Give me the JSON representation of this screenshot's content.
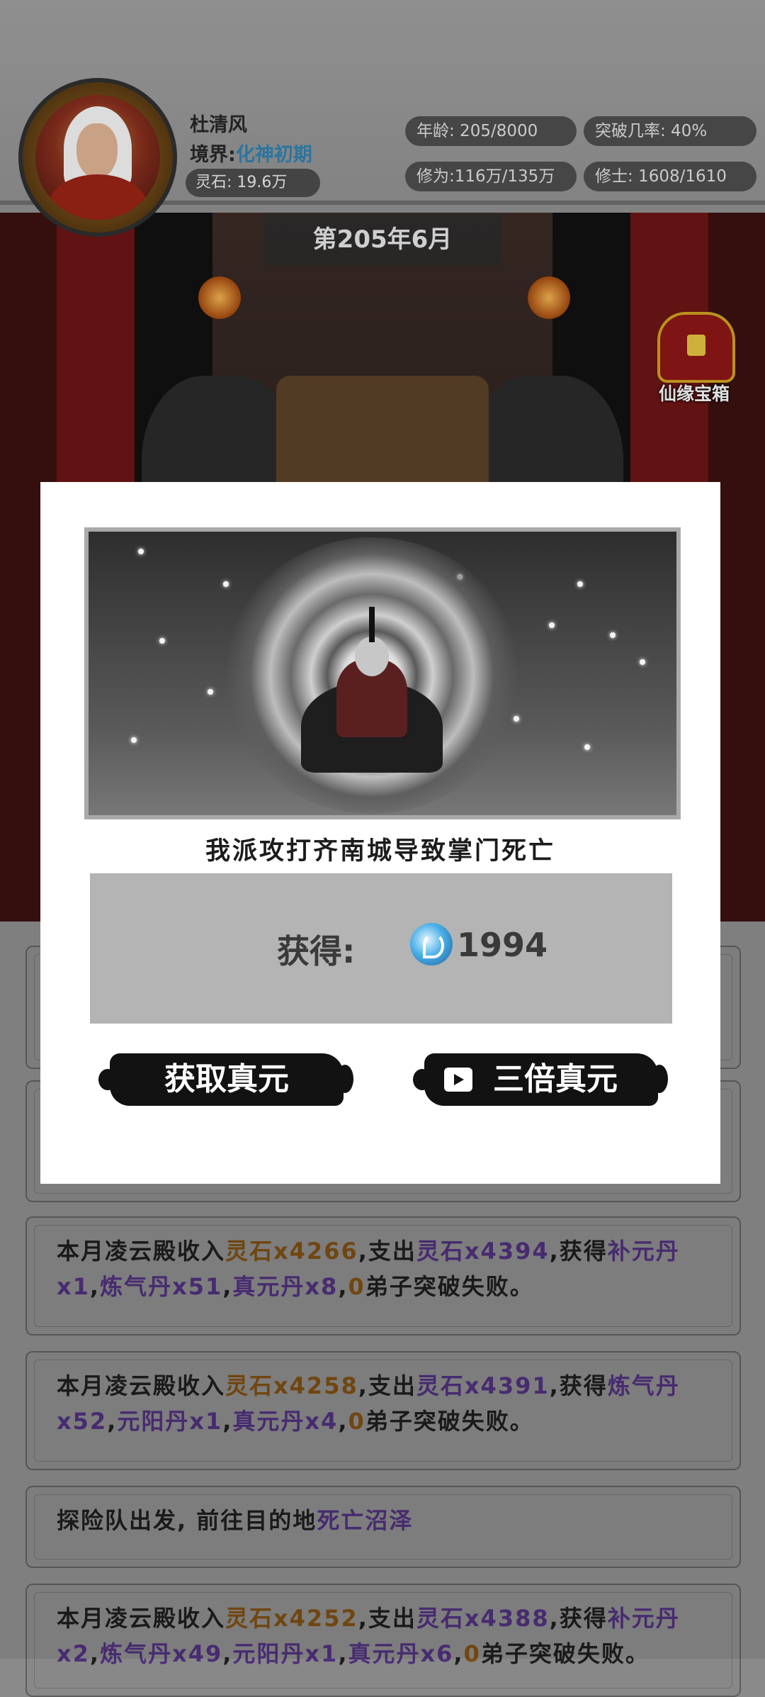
{
  "player": {
    "name": "杜清风",
    "realm_label": "境界:",
    "realm_value": "化神初期",
    "spirit_stone": "灵石: 19.6万"
  },
  "stats": {
    "age": "年龄: 205/8000",
    "breakthrough_rate": "突破几率: 40%",
    "cultivation": "修为:116万/135万",
    "cultivators": "修士: 1608/1610"
  },
  "date": "第205年6月",
  "chest_label": "仙缘宝箱",
  "logs": [
    {
      "segments": [
        {
          "text": "本月凌云殿收入",
          "c": ""
        },
        {
          "text": "灵石x4266",
          "c": "orange"
        },
        {
          "text": ",支出",
          "c": ""
        },
        {
          "text": "灵石x4394",
          "c": "purple"
        },
        {
          "text": ",获得",
          "c": ""
        },
        {
          "text": "补元丹x1",
          "c": "purple"
        },
        {
          "text": ",",
          "c": ""
        },
        {
          "text": "炼气丹x51",
          "c": "purple"
        },
        {
          "text": ",",
          "c": ""
        },
        {
          "text": "真元丹x8",
          "c": "purple"
        },
        {
          "text": ",",
          "c": ""
        },
        {
          "text": "0",
          "c": "orange"
        },
        {
          "text": "弟子突破失败。",
          "c": ""
        }
      ]
    },
    {
      "segments": [
        {
          "text": "本月凌云殿收入",
          "c": ""
        },
        {
          "text": "灵石x4258",
          "c": "orange"
        },
        {
          "text": ",支出",
          "c": ""
        },
        {
          "text": "灵石x4391",
          "c": "purple"
        },
        {
          "text": ",获得",
          "c": ""
        },
        {
          "text": "炼气丹x52",
          "c": "purple"
        },
        {
          "text": ",",
          "c": ""
        },
        {
          "text": "元阳丹x1",
          "c": "purple"
        },
        {
          "text": ",",
          "c": ""
        },
        {
          "text": "真元丹x4",
          "c": "purple"
        },
        {
          "text": ",",
          "c": ""
        },
        {
          "text": "0",
          "c": "orange"
        },
        {
          "text": "弟子突破失败。",
          "c": ""
        }
      ]
    },
    {
      "segments": [
        {
          "text": "探险队出发, 前往目的地",
          "c": ""
        },
        {
          "text": "死亡沼泽",
          "c": "purple"
        }
      ]
    },
    {
      "segments": [
        {
          "text": "本月凌云殿收入",
          "c": ""
        },
        {
          "text": "灵石x4252",
          "c": "orange"
        },
        {
          "text": ",支出",
          "c": ""
        },
        {
          "text": "灵石x4388",
          "c": "purple"
        },
        {
          "text": ",获得",
          "c": ""
        },
        {
          "text": "补元丹x2",
          "c": "purple"
        },
        {
          "text": ",",
          "c": ""
        },
        {
          "text": "炼气丹x49",
          "c": "purple"
        },
        {
          "text": ",",
          "c": ""
        },
        {
          "text": "元阳丹x1",
          "c": "purple"
        },
        {
          "text": ",",
          "c": ""
        },
        {
          "text": "真元丹x6",
          "c": "purple"
        },
        {
          "text": ",",
          "c": ""
        },
        {
          "text": "0",
          "c": "orange"
        },
        {
          "text": "弟子突破失败。",
          "c": ""
        }
      ]
    }
  ],
  "modal": {
    "event_text": "我派攻打齐南城导致掌门死亡",
    "reward_label": "获得:",
    "reward_icon": "spirit-flame-icon",
    "reward_value": "1994",
    "btn_get": "获取真元",
    "btn_triple": "三倍真元"
  },
  "colors": {
    "orange": "#7a4d12",
    "purple": "#4e2f7a",
    "realm": "#2f7fae"
  }
}
